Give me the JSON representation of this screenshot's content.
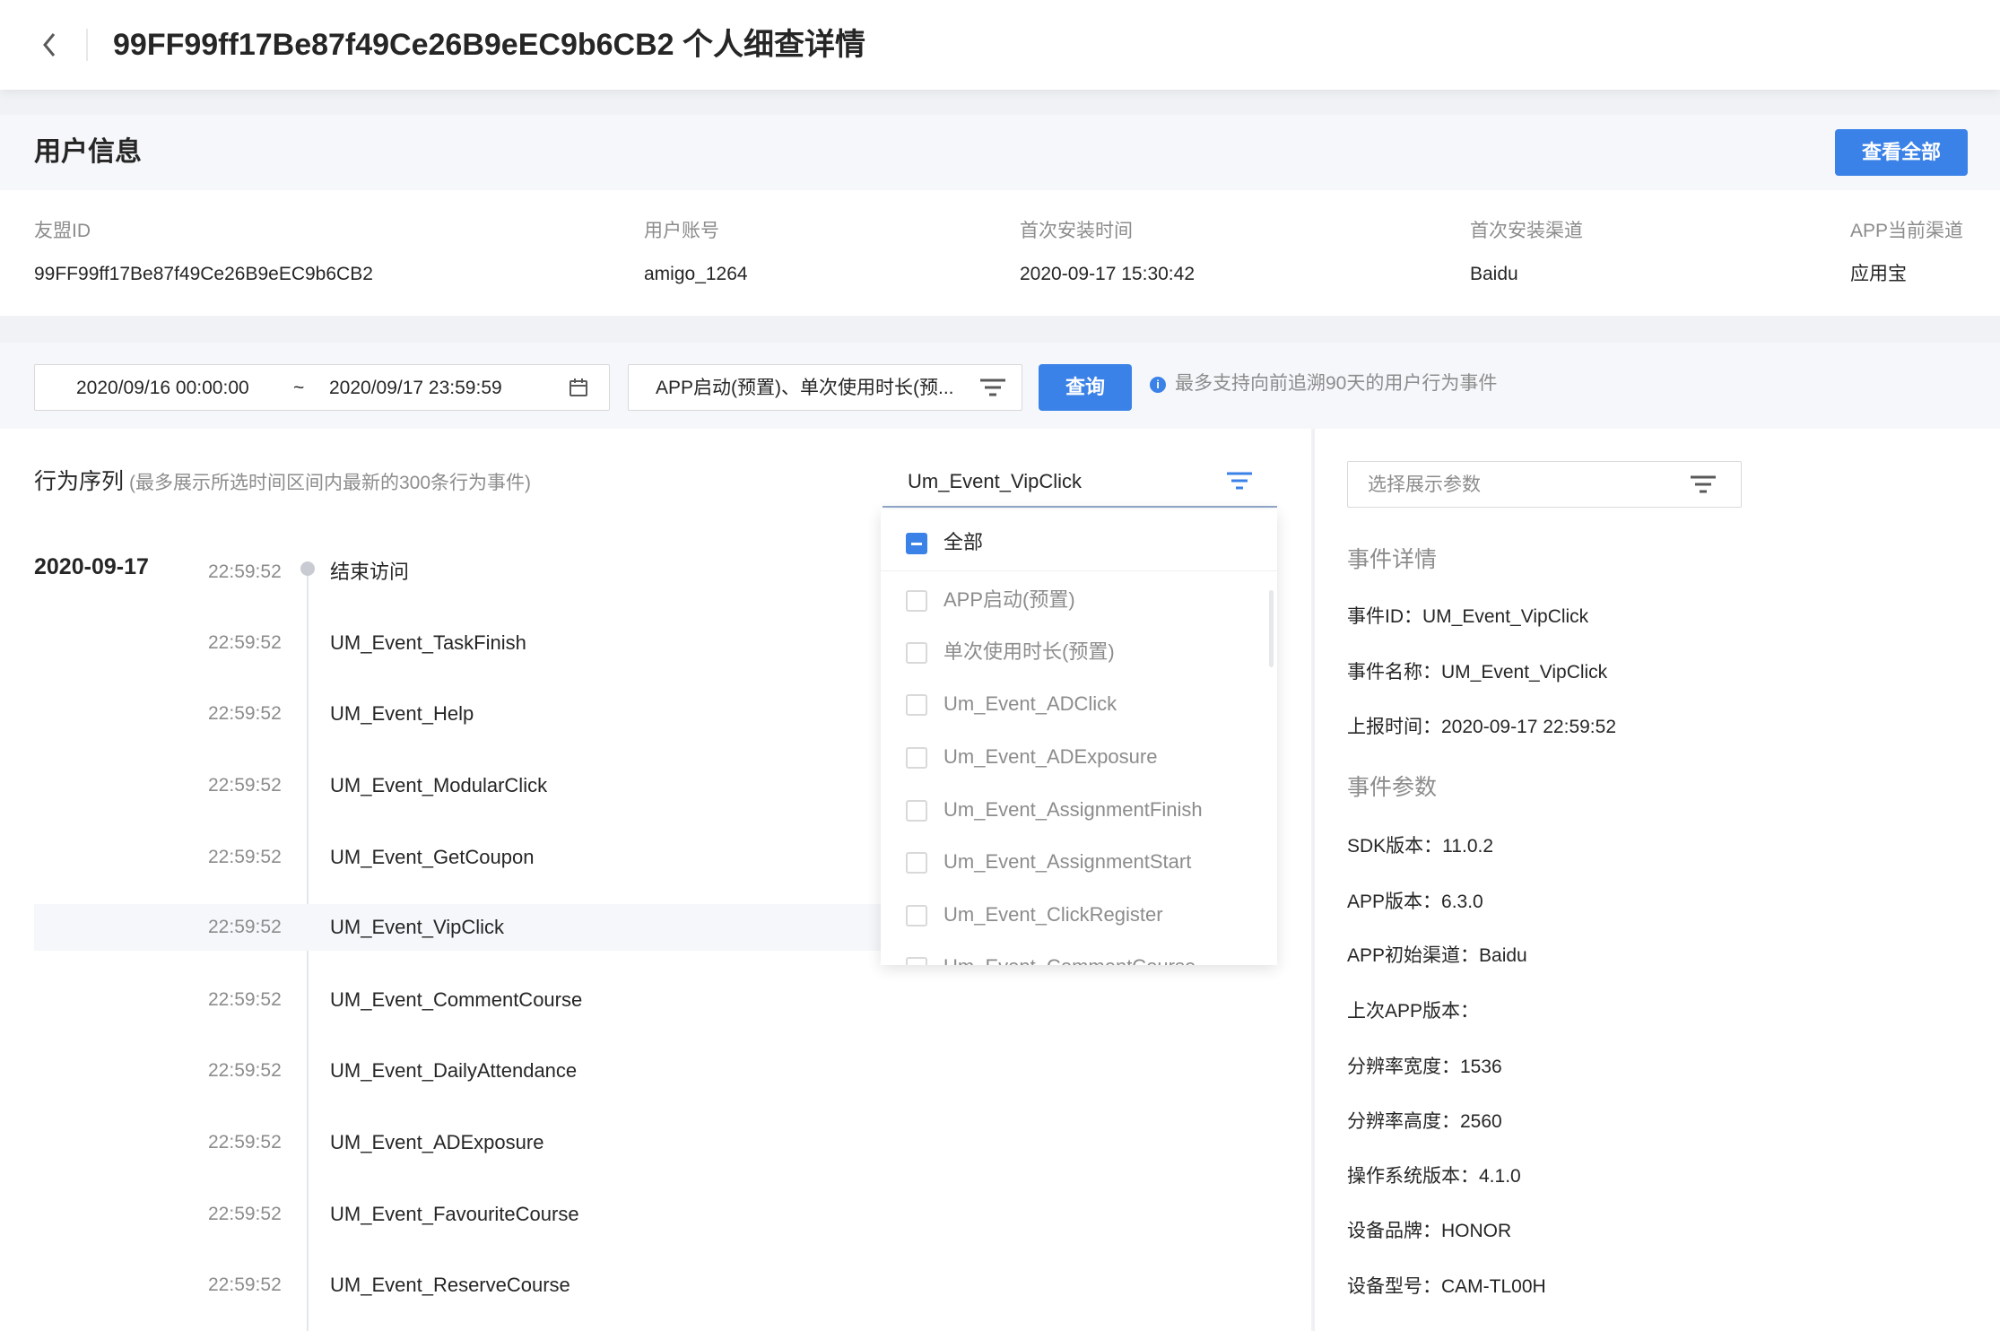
{
  "header": {
    "title": "99FF99ff17Be87f49Ce26B9eEC9b6CB2 个人细查详情"
  },
  "user_info": {
    "section_title": "用户信息",
    "view_all_label": "查看全部",
    "fields": [
      {
        "label": "友盟ID",
        "value": "99FF99ff17Be87f49Ce26B9eEC9b6CB2"
      },
      {
        "label": "用户账号",
        "value": "amigo_1264"
      },
      {
        "label": "首次安装时间",
        "value": "2020-09-17 15:30:42"
      },
      {
        "label": "首次安装渠道",
        "value": "Baidu"
      },
      {
        "label": "APP当前渠道",
        "value": "应用宝"
      }
    ]
  },
  "filters": {
    "date_start": "2020/09/16 00:00:00",
    "date_sep": "~",
    "date_end": "2020/09/17 23:59:59",
    "event_select_value": "APP启动(预置)、单次使用时长(预...",
    "query_label": "查询",
    "hint": "最多支持向前追溯90天的用户行为事件"
  },
  "sequence": {
    "title": "行为序列",
    "subtitle": "(最多展示所选时间区间内最新的300条行为事件)",
    "date": "2020-09-17",
    "events": [
      {
        "time": "22:59:52",
        "name": "结束访问"
      },
      {
        "time": "22:59:52",
        "name": "UM_Event_TaskFinish"
      },
      {
        "time": "22:59:52",
        "name": "UM_Event_Help"
      },
      {
        "time": "22:59:52",
        "name": "UM_Event_ModularClick"
      },
      {
        "time": "22:59:52",
        "name": "UM_Event_GetCoupon"
      },
      {
        "time": "22:59:52",
        "name": "UM_Event_VipClick"
      },
      {
        "time": "22:59:52",
        "name": "UM_Event_CommentCourse"
      },
      {
        "time": "22:59:52",
        "name": "UM_Event_DailyAttendance"
      },
      {
        "time": "22:59:52",
        "name": "UM_Event_ADExposure"
      },
      {
        "time": "22:59:52",
        "name": "UM_Event_FavouriteCourse"
      },
      {
        "time": "22:59:52",
        "name": "UM_Event_ReserveCourse"
      }
    ]
  },
  "event_filter": {
    "value": "Um_Event_VipClick",
    "all_label": "全部",
    "options": [
      "APP启动(预置)",
      "单次使用时长(预置)",
      "Um_Event_ADClick",
      "Um_Event_ADExposure",
      "Um_Event_AssignmentFinish",
      "Um_Event_AssignmentStart",
      "Um_Event_ClickRegister",
      "Um_Event_CommentCourse"
    ]
  },
  "details": {
    "param_placeholder": "选择展示参数",
    "event_section": "事件详情",
    "event_fields": [
      "事件ID：UM_Event_VipClick",
      "事件名称：UM_Event_VipClick",
      "上报时间：2020-09-17 22:59:52"
    ],
    "param_section": "事件参数",
    "param_fields": [
      "SDK版本：11.0.2",
      "APP版本：6.3.0",
      "APP初始渠道：Baidu",
      "上次APP版本：",
      "分辨率宽度：1536",
      "分辨率高度：2560",
      "操作系统版本：4.1.0",
      "设备品牌：HONOR",
      "设备型号：CAM-TL00H"
    ]
  },
  "colors": {
    "primary": "#3b82e8",
    "page_bg": "#f0f2f5",
    "muted_text": "#8c8c8c"
  },
  "icons": [
    "chevron-left-icon",
    "calendar-icon",
    "filter-icon",
    "info-icon"
  ]
}
